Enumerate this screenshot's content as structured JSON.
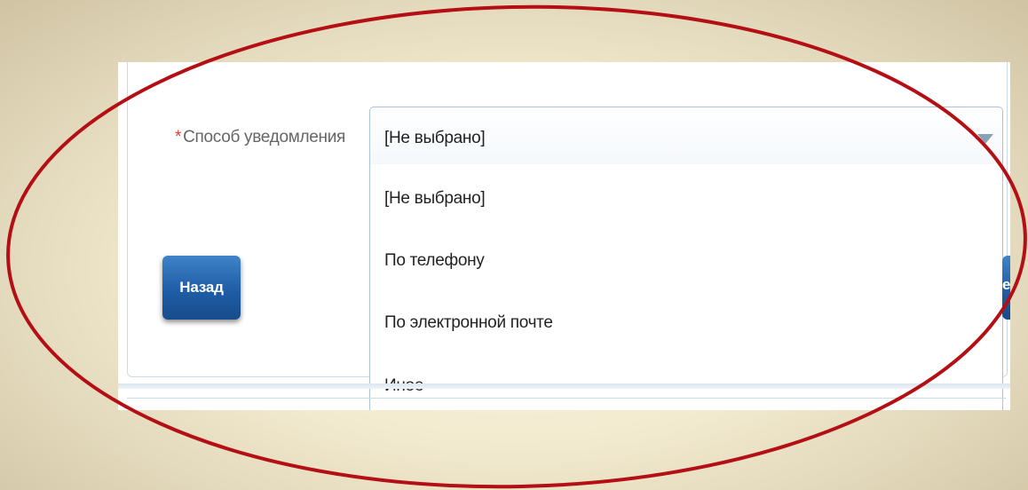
{
  "form": {
    "field_label": "Способ уведомления",
    "required_marker": "*",
    "selected_value": "[Не выбрано]",
    "options": [
      "[Не выбрано]",
      "По телефону",
      "По электронной почте",
      "Иное"
    ],
    "back_button_label": "Назад",
    "right_button_label_fragment": "е"
  },
  "colors": {
    "highlight_ellipse": "#b30f14",
    "button_primary": "#1f5da6",
    "required_marker": "#e53935",
    "background": "#f3ebd0"
  },
  "icons": {
    "dropdown_arrow": "chevron-down-icon"
  }
}
